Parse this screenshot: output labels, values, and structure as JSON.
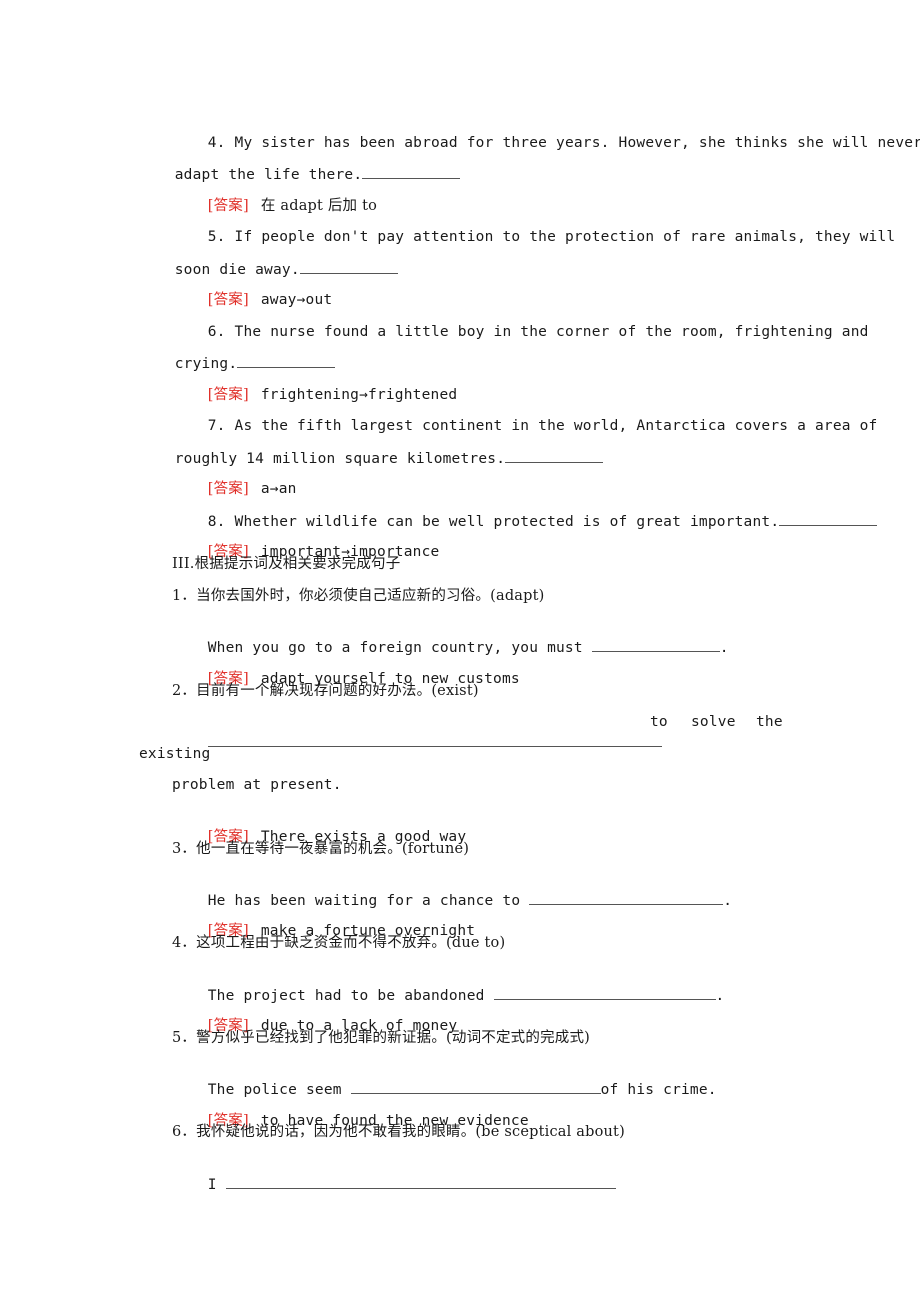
{
  "answer_tag": "[答案]",
  "section2_items": [
    {
      "number": "4.",
      "line1": "My sister has been abroad for three years. However, she thinks she will never",
      "line2": "adapt the life there.",
      "answer": "在 adapt 后加 to"
    },
    {
      "number": "5.",
      "line1": "If people don't pay attention to the protection of rare animals, they will",
      "line2": "soon die away.",
      "answer": "away→out"
    },
    {
      "number": "6.",
      "line1": "The nurse found a little boy in the corner of the room, frightening and",
      "line2": "crying.",
      "answer": "frightening→frightened"
    },
    {
      "number": "7.",
      "line1": "As the fifth largest continent in the world, Antarctica covers a area of",
      "line2": "roughly 14 million square kilometres.",
      "answer": "a→an"
    },
    {
      "number": "8.",
      "line1": "Whether wildlife can be well protected is of great important.",
      "answer": "important→importance"
    }
  ],
  "section3": {
    "heading": "III.根据提示词及相关要求完成句子",
    "items": [
      {
        "prompt": "1．当你去国外时，你必须使自己适应新的习俗。(adapt)",
        "sentence_before": "When you go to a foreign country, you must",
        "sentence_after": ".",
        "answer": "adapt yourself to new customs"
      },
      {
        "prompt": "2．目前有一个解决现存问题的好办法。(exist)",
        "sentence_mid_words": [
          "to",
          "solve",
          "the"
        ],
        "sentence_wrap": "existing",
        "sentence_line3": "problem at present.",
        "answer": "There exists a good way"
      },
      {
        "prompt": "3．他一直在等待一夜暴富的机会。(fortune)",
        "sentence_before": "He has been waiting for a chance to",
        "sentence_after": ".",
        "answer": "make a fortune overnight"
      },
      {
        "prompt": "4．这项工程由于缺乏资金而不得不放弃。(due to)",
        "sentence_before": "The project had to be abandoned",
        "sentence_after": ".",
        "answer": "due to a lack of money"
      },
      {
        "prompt": "5．警方似乎已经找到了他犯罪的新证据。(动词不定式的完成式)",
        "sentence_before": "The police seem",
        "sentence_after": "of his crime.",
        "answer": "to have found the new evidence"
      },
      {
        "prompt": "6．我怀疑他说的话，因为他不敢看我的眼睛。(be sceptical about)",
        "sentence_before": "I"
      }
    ]
  }
}
